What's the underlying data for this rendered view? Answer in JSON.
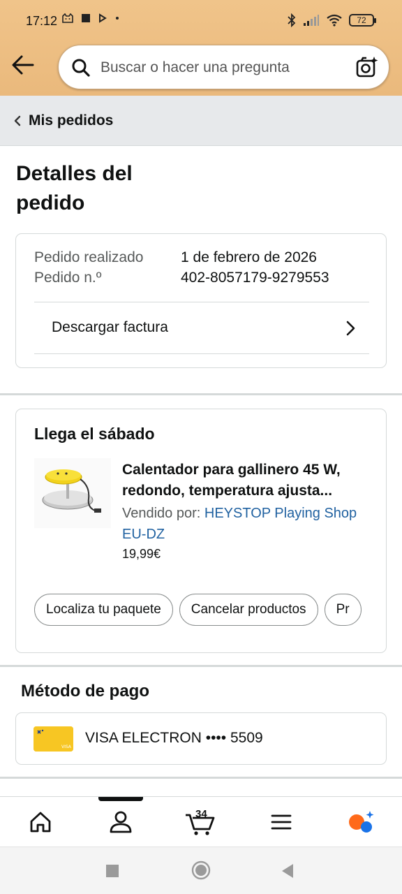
{
  "status_bar": {
    "time": "17:12",
    "battery": "72"
  },
  "search": {
    "placeholder": "Buscar o hacer una pregunta"
  },
  "breadcrumb": {
    "label": "Mis pedidos"
  },
  "page": {
    "title": "Detalles del pedido"
  },
  "order_info": {
    "placed_label": "Pedido realizado",
    "placed_value": "1 de febrero de 2026",
    "number_label": "Pedido n.º",
    "number_value": "402-8057179-9279553",
    "invoice_label": "Descargar factura"
  },
  "shipment": {
    "arrival": "Llega el sábado",
    "product_name_line1": "Calentador para gallinero 45 W,",
    "product_name_line2": "redondo, temperatura ajusta...",
    "seller_prefix": "Vendido por: ",
    "seller_name": "HEYSTOP Playing Shop EU-DZ",
    "price": "19,99€",
    "buttons": [
      "Localiza tu paquete",
      "Cancelar productos",
      "Pr"
    ]
  },
  "payment": {
    "title": "Método de pago",
    "card_text": "VISA ELECTRON •••• 5509",
    "card_color": "#f7c623"
  },
  "bottom_nav": {
    "items": [
      "home-icon",
      "account-icon",
      "cart-icon",
      "menu-icon",
      "rufus-icon"
    ],
    "cart_count": "34",
    "active": "account-icon"
  },
  "colors": {
    "header_bg": "#eab97c",
    "link": "#2162a1",
    "breadcrumb_bg": "#e7e9eb"
  }
}
